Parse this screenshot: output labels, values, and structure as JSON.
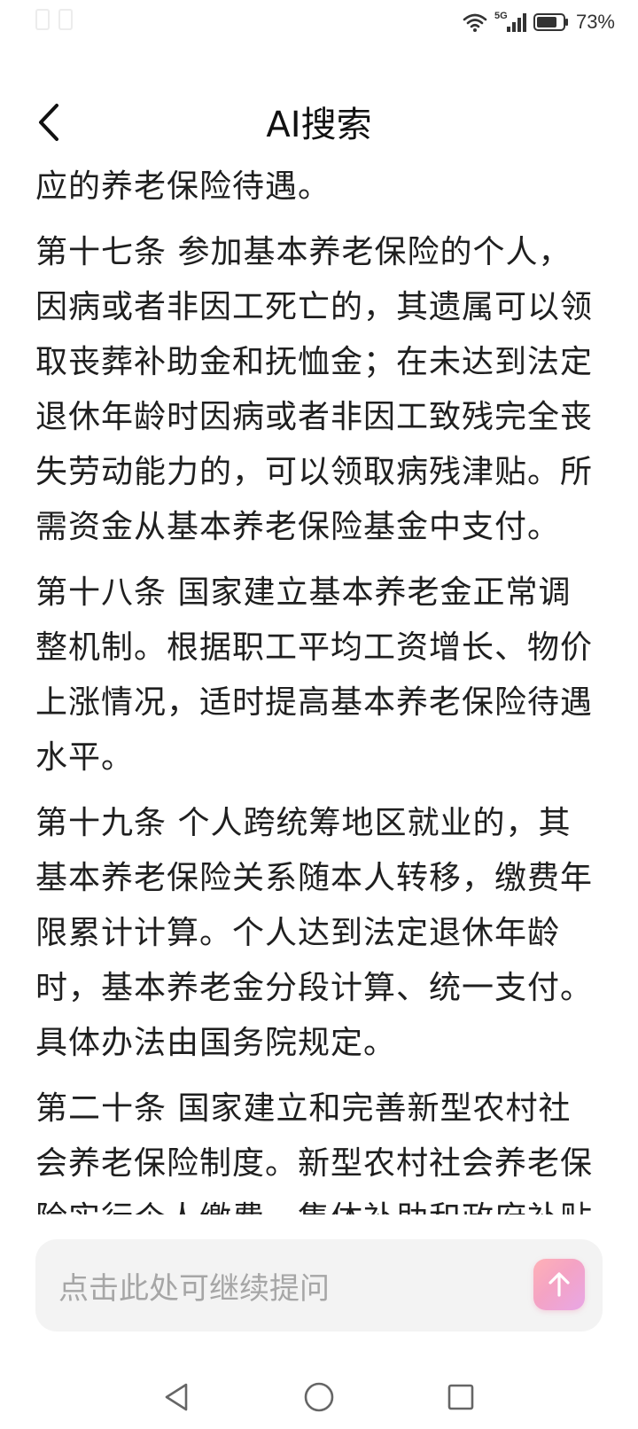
{
  "status_bar": {
    "network_label": "5G",
    "battery_percent": "73%"
  },
  "header": {
    "title": "AI搜索",
    "back_icon": "chevron-left-icon"
  },
  "article": {
    "paragraphs": [
      "应的养老保险待遇。",
      "第十七条 参加基本养老保险的个人，因病或者非因工死亡的，其遗属可以领取丧葬补助金和抚恤金；在未达到法定退休年龄时因病或者非因工致残完全丧失劳动能力的，可以领取病残津贴。所需资金从基本养老保险基金中支付。",
      "第十八条 国家建立基本养老金正常调整机制。根据职工平均工资增长、物价上涨情况，适时提高基本养老保险待遇水平。",
      "第十九条 个人跨统筹地区就业的，其基本养老保险关系随本人转移，缴费年限累计计算。个人达到法定退休年龄时，基本养老金分段计算、统一支付。具体办法由国务院规定。",
      "第二十条 国家建立和完善新型农村社会养老保险制度。新型农村社会养老保险实行个人缴费、集体补助和政府补贴相"
    ]
  },
  "input": {
    "placeholder": "点击此处可继续提问",
    "send_icon": "arrow-up-icon"
  },
  "nav_bar": {
    "icons": [
      "nav-back-icon",
      "nav-home-icon",
      "nav-recents-icon"
    ]
  },
  "colors": {
    "text": "#1f1f1f",
    "placeholder": "#a6a6a6",
    "input_bg": "#f3f3f3",
    "send_gradient_start": "#ffb1b6",
    "send_gradient_end": "#e8a7e6"
  }
}
